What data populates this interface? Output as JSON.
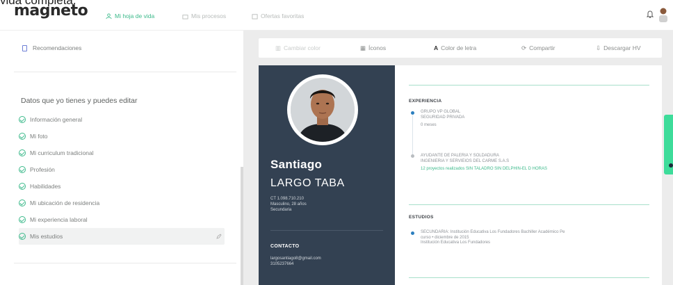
{
  "cut_text": "vida completa.",
  "header": {
    "logo": "magneto",
    "nav": [
      {
        "label": "Mi hoja de vida",
        "active": true,
        "icon": "person-icon"
      },
      {
        "label": "Mis procesos",
        "active": false,
        "icon": "briefcase-icon"
      },
      {
        "label": "Ofertas favoritas",
        "active": false,
        "icon": "bookmark-icon"
      }
    ]
  },
  "sidebar": {
    "recommendations_label": "Recomendaciones",
    "section_title": "Datos que yo tienes y puedes editar",
    "items": [
      {
        "label": "Información general"
      },
      {
        "label": "Mi foto"
      },
      {
        "label": "Mi curriculum tradicional"
      },
      {
        "label": "Profesión"
      },
      {
        "label": "Habilidades"
      },
      {
        "label": "Mi ubicación de residencia"
      },
      {
        "label": "Mi experiencia laboral"
      },
      {
        "label": "Mis estudios",
        "selected": true
      }
    ]
  },
  "toolbar": {
    "change_color": "Cambiar color",
    "icons": "Íconos",
    "font_color": "Color de letra",
    "share": "Compartir",
    "download": "Descargar HV"
  },
  "cv": {
    "first_name": "Santiago",
    "last_name": "LARGO TABA",
    "meta": [
      "CT 1.098.710.210",
      "Masculino, 28 años",
      "Secundaria"
    ],
    "contact_title": "CONTACTO",
    "contact": [
      "largosantiago8@gmail.com",
      "3105237664"
    ],
    "experience_title": "EXPERIENCIA",
    "experience": [
      {
        "lines": [
          "GRUPO VP GLOBAL",
          "SEGURIDAD PRIVADA"
        ],
        "extra": "0 meses"
      },
      {
        "lines": [
          "AYUDANTE DE PALERIA Y SOLDADURA",
          "INGENIERIA Y SERVIEIOS DEL CARME S.A.S"
        ],
        "extra": "12 proyectos realizados SIN TALADRO SIN DELPHIN-EL D HORAS"
      }
    ],
    "studies_title": "ESTUDIOS",
    "studies": [
      {
        "lines": [
          "SECUNDARIA: Institución Educativa Los Fundadores Bachiller Académico Pe",
          "curso • diciembre de 2015",
          "Institución Educativa Los Fundadores"
        ]
      }
    ]
  },
  "colors": {
    "accent": "#3bb98a",
    "cv_dark": "#334152",
    "side_tab": "#3ddc9a"
  }
}
